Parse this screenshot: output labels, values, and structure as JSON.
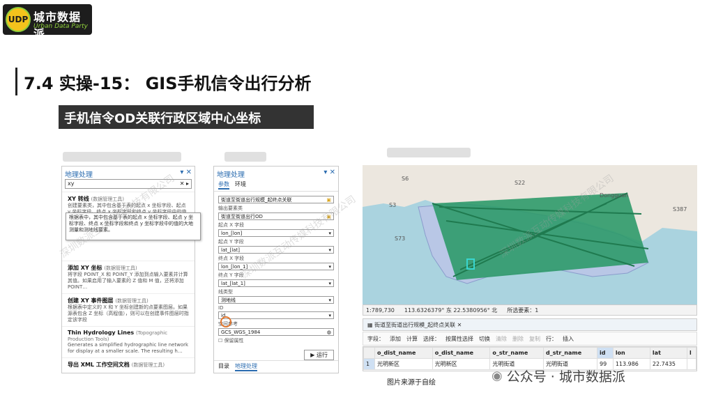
{
  "logo": {
    "badge": "UDP",
    "name": "城市数据派",
    "tagline": "Urban Data Party"
  },
  "title": "7.4 实操-15： GIS手机信令出行分析",
  "subtitle": "手机信令OD关联行政区域中心坐标",
  "left_panel": {
    "title": "地理处理",
    "search": "xy",
    "tools": [
      {
        "name": "XY 转线",
        "tag": "(数据管理工具)",
        "desc": "创建要素类，其中包含基于表的起点 x 坐标字段、起点 y 坐标字段、终点 x 坐标字段和终点 y 坐标字段中的值的"
      },
      {
        "name": "添加 XY 坐标",
        "tag": "(数据管理工具)",
        "desc": "将字段 POINT_X 和 POINT_Y 添加到点输入要素并计算其值。如果启用了输入要素的 Z 值和 M 值，还将添加 POINT…"
      },
      {
        "name": "创建 XY 事件图层",
        "tag": "(数据管理工具)",
        "desc": "根据表中定义的 X 和 Y 坐标创建新的点要素图层。如果源表包含 Z 坐标（高程值），则可以在创建事件图层时指定该字段"
      },
      {
        "name": "Thin Hydrology Lines",
        "tag": "(Topographic Production Tools)",
        "desc": "Generates a simplified hydrographic line network for display at a smaller scale. The resulting h…"
      },
      {
        "name": "导出 XML 工作空间文档",
        "tag": "(数据管理工具)",
        "desc": ""
      }
    ],
    "tooltip": "根据表中，其中包含基于表的起点 x 坐标字段、起点 y 坐标字段、终点 x 坐标字段和终点 y 坐标字段中的值的大地测量和测地线要素。"
  },
  "mid_panel": {
    "title": "地理处理",
    "tabs": [
      "参数",
      "环境"
    ],
    "fields": [
      {
        "label": "",
        "value": "街道至街道出行规模_起终点关联"
      },
      {
        "label": "输出要素类",
        "value": "街道至街道出行OD"
      },
      {
        "label": "起点 X 字段",
        "value": "lon_[lon]"
      },
      {
        "label": "起点 Y 字段",
        "value": "lat_[lat]"
      },
      {
        "label": "终点 X 字段",
        "value": "lon_[lon_1]"
      },
      {
        "label": "终点 Y 字段",
        "value": "lat_[lat_1]"
      },
      {
        "label": "线类型",
        "value": "测地线"
      },
      {
        "label": "ID",
        "value": "id"
      },
      {
        "label": "空间参考",
        "value": "GCS_WGS_1984"
      }
    ],
    "checkbox": "保留属性",
    "run": "运行",
    "bottom_tabs": [
      "目录",
      "地理处理"
    ]
  },
  "map": {
    "labels": [
      "S6",
      "S22",
      "S3",
      "S73",
      "S387",
      "Dongguan"
    ],
    "scale": "1:789,730",
    "coords": "113.6326379° 东  22.5380956° 北",
    "selected": "所选要素：1"
  },
  "attr": {
    "tab": "街道至街道出行规模_起终点关联",
    "toolbar": [
      "字段：",
      "添加",
      "计算",
      "选择：",
      "按属性选择",
      "切换",
      "清除",
      "删除",
      "复制",
      "行：",
      "插入"
    ],
    "columns": [
      "",
      "o_dist_name",
      "o_dist_name",
      "o_str_name",
      "d_str_name",
      "id",
      "lon",
      "lat",
      "l"
    ],
    "rows": [
      [
        "1",
        "光明新区",
        "光明新区",
        "光明街道",
        "光明街道",
        "99",
        "113.986",
        "22.7435",
        ""
      ]
    ]
  },
  "caption": "图片来源于自绘",
  "wechat": "公众号 · 城市数据派",
  "watermark": "深圳数派互动传媒科技有限公司"
}
